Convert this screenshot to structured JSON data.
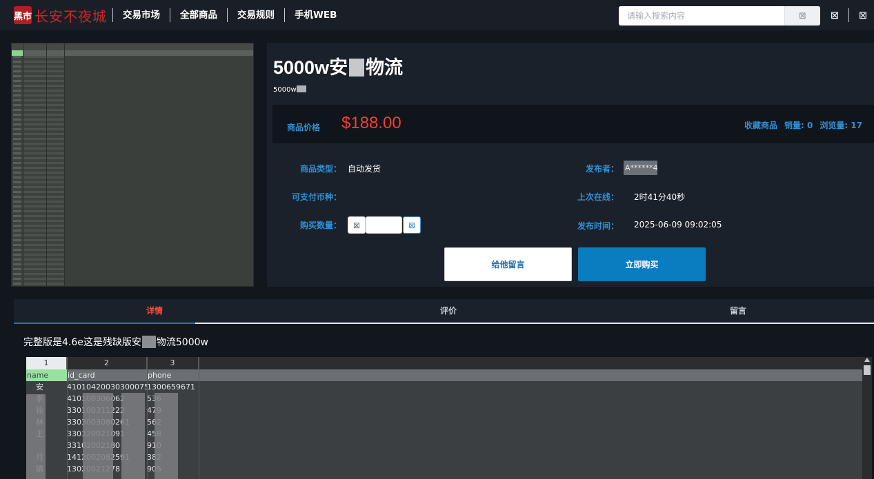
{
  "header": {
    "logo_badge": "黑市",
    "logo_text": "长安不夜城",
    "nav": [
      "交易市场",
      "全部商品",
      "交易规则",
      "手机WEB"
    ],
    "search_placeholder": "请输入搜索内容",
    "search_icon_glyph": "⊠",
    "user_icon_glyph": "⊠",
    "menu_icon_glyph": "⊠"
  },
  "product": {
    "title_prefix": "5000w安",
    "title_suffix": "物流",
    "subtitle": "5000w",
    "price_label": "商品价格",
    "price": "$188.00",
    "favorite": "收藏商品",
    "sales": "销量: 0",
    "views": "浏览量: 17",
    "type_label": "商品类型：",
    "type_value": "自动发货",
    "currency_label": "可支付币种：",
    "qty_label": "购买数量：",
    "qty_minus_glyph": "⊠",
    "qty_plus_glyph": "⊠",
    "qty_value": "",
    "publisher_label": "发布者：",
    "publisher_value": "A******4",
    "last_online_label": "上次在线：",
    "last_online_value": "2时41分40秒",
    "publish_time_label": "发布时间：",
    "publish_time_value": "2025-06-09 09:02:05",
    "btn_message": "给他留言",
    "btn_buy": "立即购买"
  },
  "tabs": [
    {
      "label": "详情",
      "active": true
    },
    {
      "label": "评价",
      "active": false
    },
    {
      "label": "留言",
      "active": false
    }
  ],
  "detail": {
    "text_prefix": "完整版是4.6e这是残缺版安",
    "text_suffix": "物流5000w"
  },
  "sheet": {
    "col_numbers": [
      "1",
      "2",
      "3"
    ],
    "headers": [
      "name",
      "id_card",
      "phone"
    ],
    "rows": [
      [
        "安",
        "41010420030300075",
        "1300659671"
      ],
      [
        "李",
        "410100306062",
        "536"
      ],
      [
        "徐",
        "330100311222",
        "479"
      ],
      [
        "林",
        "3303003080261",
        "562"
      ],
      [
        "王",
        "330320021091",
        "458"
      ],
      [
        "",
        "33102002180",
        "910"
      ],
      [
        "月",
        "1412002082591",
        "382"
      ],
      [
        "婧",
        "13020021278",
        "905"
      ]
    ]
  }
}
